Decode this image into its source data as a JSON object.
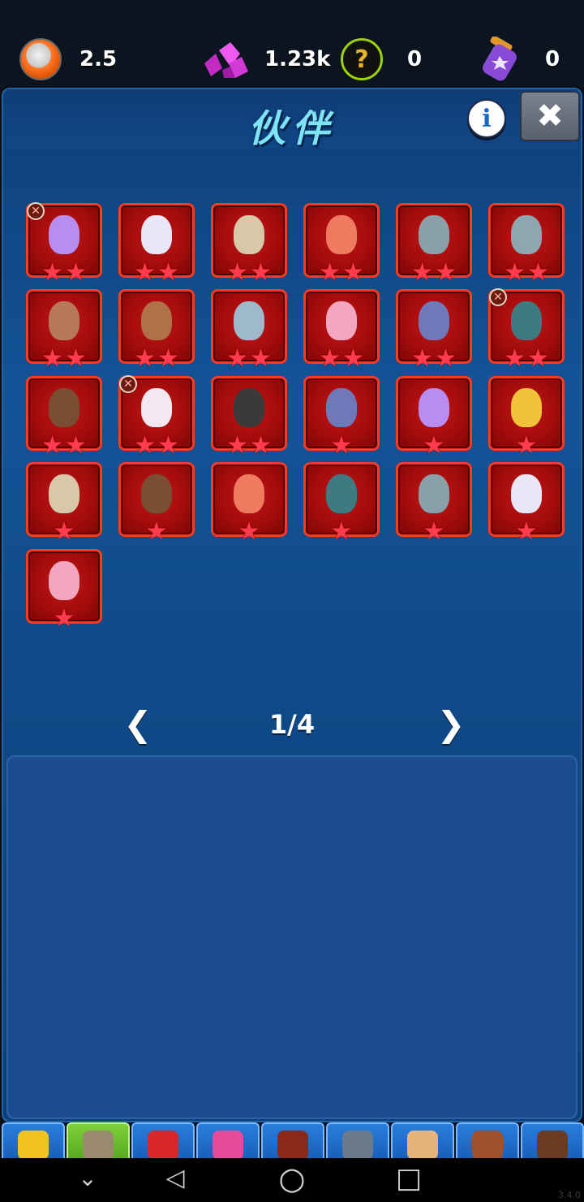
{
  "resources": {
    "coins": "2.5",
    "gems": "1.23k",
    "mystery": "0",
    "potions": "0"
  },
  "panel": {
    "title": "伙伴",
    "info_label": "i",
    "close_label": "✖"
  },
  "companions": [
    {
      "animal": "purple-bird",
      "color": "#b88cf0",
      "stars": 2,
      "locked": true
    },
    {
      "animal": "polar-bear",
      "color": "#e9e6f5",
      "stars": 2,
      "locked": false
    },
    {
      "animal": "owl",
      "color": "#d8c8a8",
      "stars": 2,
      "locked": false
    },
    {
      "animal": "parrot",
      "color": "#f07a60",
      "stars": 2,
      "locked": false
    },
    {
      "animal": "hippo",
      "color": "#8aa0a8",
      "stars": 2,
      "locked": false
    },
    {
      "animal": "seal",
      "color": "#8ea6b0",
      "stars": 2,
      "locked": false
    },
    {
      "animal": "deer",
      "color": "#b8785a",
      "stars": 2,
      "locked": false
    },
    {
      "animal": "walrus",
      "color": "#b07048",
      "stars": 2,
      "locked": false
    },
    {
      "animal": "elephant",
      "color": "#9eb8cc",
      "stars": 2,
      "locked": false
    },
    {
      "animal": "flamingo",
      "color": "#f2a6c0",
      "stars": 2,
      "locked": false
    },
    {
      "animal": "rhino",
      "color": "#6f78b8",
      "stars": 2,
      "locked": false
    },
    {
      "animal": "bear",
      "color": "#3e7a82",
      "stars": 2,
      "locked": true
    },
    {
      "animal": "buffalo",
      "color": "#7a4e32",
      "stars": 2,
      "locked": false
    },
    {
      "animal": "penguin",
      "color": "#f4e8f0",
      "stars": 2,
      "locked": true
    },
    {
      "animal": "ostrich",
      "color": "#3a3a3a",
      "stars": 2,
      "locked": false
    },
    {
      "animal": "rhino",
      "color": "#6f78b8",
      "stars": 1,
      "locked": false
    },
    {
      "animal": "purple-bird",
      "color": "#b88cf0",
      "stars": 1,
      "locked": false
    },
    {
      "animal": "chick",
      "color": "#f2c23a",
      "stars": 1,
      "locked": false
    },
    {
      "animal": "owl",
      "color": "#d8c8a8",
      "stars": 1,
      "locked": false
    },
    {
      "animal": "buffalo",
      "color": "#7a4e32",
      "stars": 1,
      "locked": false
    },
    {
      "animal": "parrot",
      "color": "#f07a60",
      "stars": 1,
      "locked": false
    },
    {
      "animal": "bear",
      "color": "#3e7a82",
      "stars": 1,
      "locked": false
    },
    {
      "animal": "hippo",
      "color": "#8aa0a8",
      "stars": 1,
      "locked": false
    },
    {
      "animal": "polar-bear",
      "color": "#e9e6f5",
      "stars": 1,
      "locked": false
    },
    {
      "animal": "flamingo",
      "color": "#f2a6c0",
      "stars": 1,
      "locked": false
    }
  ],
  "pager": {
    "prev_label": "❮",
    "page": "1/4",
    "next_label": "❯"
  },
  "tabs": [
    {
      "icon": "profile-icon",
      "color": "#f2c21e",
      "active": false
    },
    {
      "icon": "companion-icon",
      "color": "#9a8a70",
      "active": true
    },
    {
      "icon": "dragon-icon",
      "color": "#d8282a",
      "active": false
    },
    {
      "icon": "orb-icon",
      "color": "#e84a9a",
      "active": false
    },
    {
      "icon": "spellbook-icon",
      "color": "#8a2a1a",
      "active": false
    },
    {
      "icon": "map-icon",
      "color": "#6a7a8a",
      "active": false
    },
    {
      "icon": "scroll-icon",
      "color": "#e6b47a",
      "active": false
    },
    {
      "icon": "book-icon",
      "color": "#a0502a",
      "active": false
    },
    {
      "icon": "gear-icon",
      "color": "#6a3a22",
      "active": false
    }
  ],
  "navbar": {
    "down_label": "⌄",
    "back_label": "◁",
    "home_label": "○",
    "recents_label": "□"
  },
  "version": "3.4.0"
}
